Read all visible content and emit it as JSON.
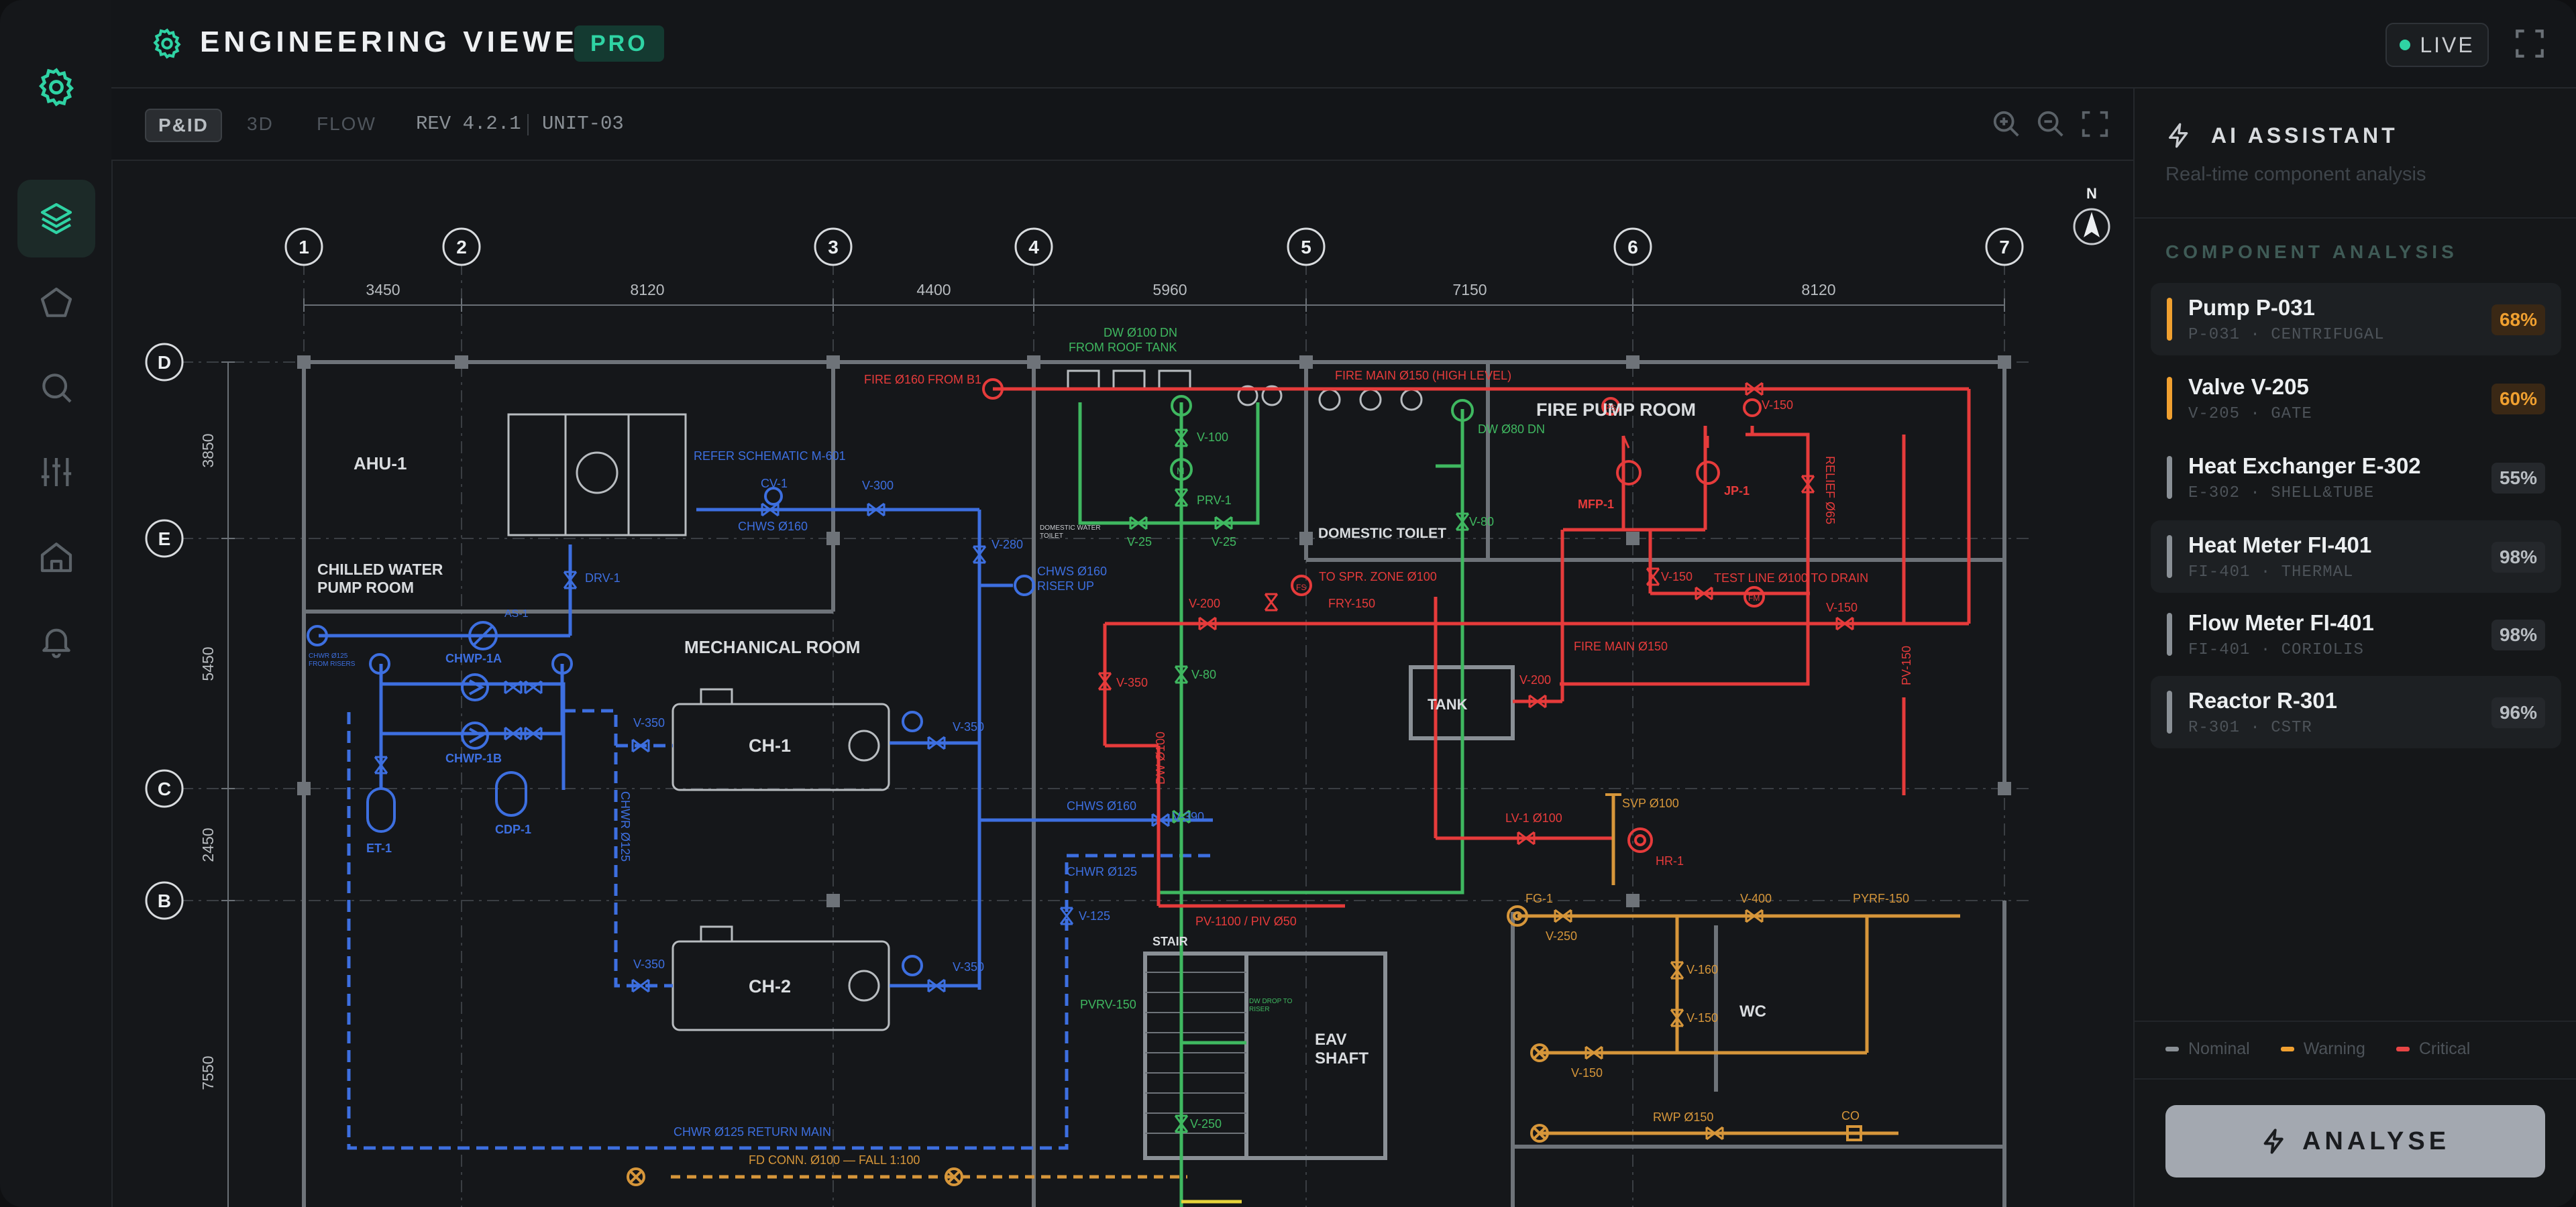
{
  "app": {
    "title": "ENGINEERING VIEWER",
    "badge": "PRO",
    "live_label": "LIVE",
    "accent": "#2fd3a4"
  },
  "sidebar": {
    "items": [
      {
        "name": "settings",
        "icon": "gear-icon",
        "active": false
      },
      {
        "name": "layers",
        "icon": "layers-icon",
        "active": true
      },
      {
        "name": "shapes",
        "icon": "pentagon-icon",
        "active": false
      },
      {
        "name": "search",
        "icon": "search-icon",
        "active": false
      },
      {
        "name": "controls",
        "icon": "sliders-icon",
        "active": false
      },
      {
        "name": "home",
        "icon": "home-icon",
        "active": false
      },
      {
        "name": "alerts",
        "icon": "bell-icon",
        "active": false
      }
    ]
  },
  "toolbar": {
    "tabs": [
      {
        "label": "P&ID",
        "active": true
      },
      {
        "label": "3D",
        "active": false
      },
      {
        "label": "FLOW",
        "active": false
      }
    ],
    "revision": "REV 4.2.1",
    "unit": "UNIT-03",
    "zoom_in_icon": "zoom-in-icon",
    "zoom_out_icon": "zoom-out-icon",
    "fit_icon": "fit-screen-icon"
  },
  "drawing": {
    "compass": "N",
    "grid_columns": [
      "1",
      "2",
      "3",
      "4",
      "5",
      "6",
      "7"
    ],
    "grid_rows": [
      "D",
      "E",
      "C",
      "B"
    ],
    "column_spacings": [
      "3450",
      "8120",
      "4400",
      "5960",
      "7150",
      "8120"
    ],
    "row_spacings": [
      "3850",
      "5450",
      "2450",
      "7550"
    ],
    "rooms": {
      "ahu": "AHU-1",
      "chilled_water_1": "CHILLED WATER",
      "chilled_water_2": "PUMP ROOM",
      "mechanical": "MECHANICAL ROOM",
      "fire_pump": "FIRE PUMP ROOM",
      "domestic_toilet": "DOMESTIC TOILET",
      "tank": "TANK",
      "stair": "STAIR",
      "eav_1": "EAV",
      "eav_2": "SHAFT",
      "wc": "WC",
      "ch1": "CH-1",
      "ch2": "CH-2"
    },
    "labels_blue": {
      "refer": "REFER SCHEMATIC M-601",
      "cv1": "CV-1",
      "chws160": "CHWS Ø160",
      "v300": "V-300",
      "v280": "V-280",
      "chws_riser_1": "CHWS Ø160",
      "chws_riser_2": "RISER UP",
      "drv1": "DRV-1",
      "as1": "AS-1",
      "chwp1a": "CHWP-1A",
      "chwp1b": "CHWP-1B",
      "et1": "ET-1",
      "cdp1": "CDP-1",
      "v350a": "V-350",
      "v350b": "V-350",
      "v350c": "V-350",
      "v350d": "V-350",
      "chwr125_vert": "CHWR Ø125",
      "chws160b": "CHWS Ø160",
      "v390": "V-390",
      "chwr125": "CHWR Ø125",
      "v125": "V-125",
      "chwr_return": "CHWR Ø125 RETURN MAIN",
      "small_left_1": "CHWR Ø125",
      "small_left_2": "FROM RISERS"
    },
    "labels_green": {
      "dw_roof_1": "DW Ø100 DN",
      "dw_roof_2": "FROM ROOF TANK",
      "v100": "V-100",
      "m": "M",
      "prv1": "PRV-1",
      "v25a": "V-25",
      "v25b": "V-25",
      "dom_toilet_small_1": "DOMESTIC WATER",
      "dom_toilet_small_2": "TOILET",
      "dw80": "DW Ø80 DN",
      "v80a": "V-80",
      "v80b": "V-80",
      "pvrv150": "PVRV-150",
      "v250": "V-250",
      "stair_small_1": "DW DROP TO",
      "stair_small_2": "RISER"
    },
    "labels_red": {
      "fire160": "FIRE Ø160 FROM B1",
      "fire_main_high": "FIRE MAIN Ø150 (HIGH LEVEL)",
      "mfp1": "MFP-1",
      "jp1": "JP-1",
      "ps": "PS",
      "v150a": "V-150",
      "relief": "RELIEF Ø65",
      "v150b": "V-150",
      "test_line": "TEST LINE Ø100 TO DRAIN",
      "fm": "FM",
      "v150c": "V-150",
      "v200a": "V-200",
      "to_spr": "TO SPR. ZONE Ø100",
      "fs": "FS",
      "fry150": "FRY-150",
      "v350": "V-350",
      "fire_main150": "FIRE MAIN Ø150",
      "v200b": "V-200",
      "pv150": "PV-150",
      "dw100_vert": "DW Ø100",
      "pv1100": "PV-1100 / PIV Ø50",
      "lv1": "LV-1 Ø100",
      "hr1": "HR-1"
    },
    "labels_orange": {
      "svp": "SVP Ø100",
      "fg1": "FG-1",
      "v250": "V-250",
      "v400": "V-400",
      "pyrf": "PYRF-150",
      "v160": "V-160",
      "v150a": "V-150",
      "v150b": "V-150",
      "rwp": "RWP Ø150",
      "co": "CO",
      "fd": "FD CONN. Ø100 — FALL 1:100"
    }
  },
  "panel": {
    "title": "AI ASSISTANT",
    "subtitle": "Real-time component analysis",
    "section": "COMPONENT ANALYSIS",
    "components": [
      {
        "name": "Pump P-031",
        "sub": "P-031 · CENTRIFUGAL",
        "pct": "68%",
        "status": "warning"
      },
      {
        "name": "Valve V-205",
        "sub": "V-205 · GATE",
        "pct": "60%",
        "status": "warning"
      },
      {
        "name": "Heat Exchanger E-302",
        "sub": "E-302 · SHELL&TUBE",
        "pct": "55%",
        "status": "nominal"
      },
      {
        "name": "Heat Meter FI-401",
        "sub": "FI-401 · THERMAL",
        "pct": "98%",
        "status": "nominal"
      },
      {
        "name": "Flow Meter FI-401",
        "sub": "FI-401 · CORIOLIS",
        "pct": "98%",
        "status": "nominal"
      },
      {
        "name": "Reactor R-301",
        "sub": "R-301 · CSTR",
        "pct": "96%",
        "status": "nominal"
      }
    ],
    "legend": [
      {
        "label": "Nominal",
        "color": "#8a9096"
      },
      {
        "label": "Warning",
        "color": "#f0a030"
      },
      {
        "label": "Critical",
        "color": "#e84545"
      }
    ],
    "analyse_label": "ANALYSE"
  },
  "colors": {
    "nominal": "#8a9096",
    "warning": "#f0a030",
    "critical": "#e84545",
    "pipe_blue": "#3d6fe0",
    "pipe_green": "#3fb860",
    "pipe_red": "#e63b3b",
    "pipe_orange": "#d6963a"
  }
}
